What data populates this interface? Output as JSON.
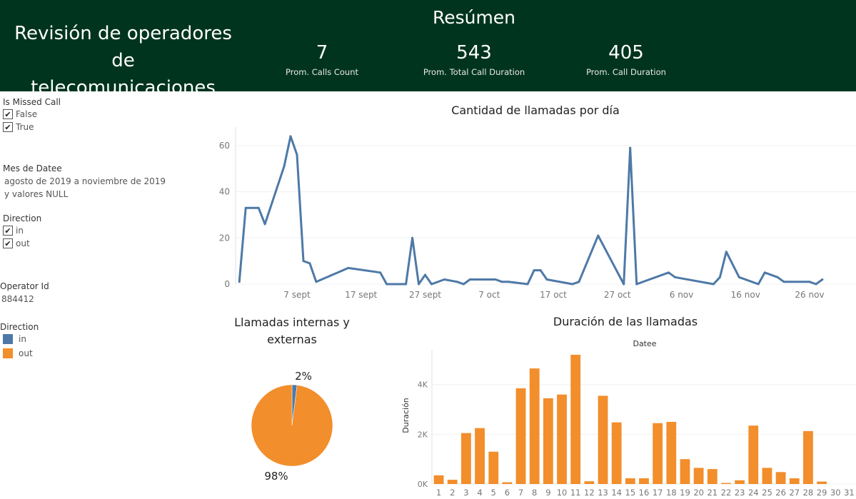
{
  "header": {
    "title_line1": "Revisión de operadores de",
    "title_line2": "telecomunicaciones",
    "summary_title": "Resúmen",
    "kpis": [
      {
        "value": "7",
        "label": "Prom. Calls Count"
      },
      {
        "value": "543",
        "label": "Prom. Total Call Duration"
      },
      {
        "value": "405",
        "label": "Prom. Call Duration"
      }
    ]
  },
  "filters": {
    "missed": {
      "title": "Is Missed Call",
      "options": [
        "False",
        "True"
      ]
    },
    "month": {
      "title": "Mes de Datee",
      "line1": "agosto de 2019 a noviembre de 2019",
      "line2": "y valores NULL"
    },
    "direction": {
      "title": "Direction",
      "options": [
        "in",
        "out"
      ]
    },
    "operator": {
      "title": "Operator Id",
      "value": "884412"
    },
    "legend": {
      "title": "Direction",
      "items": [
        "in",
        "out"
      ]
    }
  },
  "colors": {
    "header_bg": "#01341f",
    "in": "#4e79a7",
    "out": "#f28e2b"
  },
  "chart_data": [
    {
      "type": "line",
      "title": "Cantidad de llamadas por día",
      "color": "#4e79a7",
      "ylim": [
        0,
        68
      ],
      "y_ticks": [
        "0",
        "20",
        "40",
        "60"
      ],
      "x_ticks": [
        "7 sept",
        "17 sept",
        "27 sept",
        "7 oct",
        "17 oct",
        "27 oct",
        "6 nov",
        "16 nov",
        "26 nov"
      ],
      "tick_dates": [
        "2019-09-07",
        "2019-09-17",
        "2019-09-27",
        "2019-10-07",
        "2019-10-17",
        "2019-10-27",
        "2019-11-06",
        "2019-11-16",
        "2019-11-26"
      ],
      "x": [
        "2019-08-29",
        "2019-08-30",
        "2019-09-01",
        "2019-09-02",
        "2019-09-05",
        "2019-09-06",
        "2019-09-07",
        "2019-09-08",
        "2019-09-09",
        "2019-09-10",
        "2019-09-15",
        "2019-09-20",
        "2019-09-21",
        "2019-09-24",
        "2019-09-25",
        "2019-09-26",
        "2019-09-27",
        "2019-09-28",
        "2019-09-30",
        "2019-10-02",
        "2019-10-03",
        "2019-10-04",
        "2019-10-08",
        "2019-10-09",
        "2019-10-10",
        "2019-10-13",
        "2019-10-14",
        "2019-10-15",
        "2019-10-16",
        "2019-10-20",
        "2019-10-21",
        "2019-10-24",
        "2019-10-28",
        "2019-10-29",
        "2019-10-30",
        "2019-11-04",
        "2019-11-05",
        "2019-11-11",
        "2019-11-12",
        "2019-11-13",
        "2019-11-15",
        "2019-11-18",
        "2019-11-19",
        "2019-11-21",
        "2019-11-22",
        "2019-11-26",
        "2019-11-27",
        "2019-11-28"
      ],
      "y": [
        1,
        33,
        33,
        26,
        51,
        64,
        56,
        10,
        9,
        1,
        7,
        5,
        0,
        0,
        20,
        0,
        4,
        0,
        2,
        1,
        0,
        2,
        2,
        1,
        1,
        0,
        6,
        6,
        2,
        0,
        1,
        21,
        0,
        59,
        0,
        5,
        3,
        0,
        3,
        14,
        3,
        0,
        5,
        3,
        1,
        1,
        0,
        2
      ]
    },
    {
      "type": "pie",
      "title_line1": "Llamadas internas y",
      "title_line2": "externas",
      "labels": [
        "in",
        "out"
      ],
      "values": [
        2,
        98
      ],
      "value_labels": [
        "2%",
        "98%"
      ]
    },
    {
      "type": "bar",
      "title": "Duración de las llamadas",
      "xlabel": "Datee",
      "ylabel": "Duración",
      "color": "#f28e2b",
      "ylim": [
        0,
        5400
      ],
      "y_tick_values": [
        0,
        2000,
        4000
      ],
      "y_ticks": [
        "0K",
        "2K",
        "4K"
      ],
      "categories": [
        "1",
        "2",
        "3",
        "4",
        "5",
        "6",
        "7",
        "8",
        "9",
        "10",
        "11",
        "12",
        "13",
        "14",
        "15",
        "16",
        "17",
        "18",
        "19",
        "20",
        "21",
        "22",
        "23",
        "24",
        "25",
        "26",
        "27",
        "28",
        "29",
        "30",
        "31"
      ],
      "values": [
        350,
        170,
        2050,
        2250,
        1300,
        70,
        3850,
        4650,
        3450,
        3600,
        5200,
        110,
        3550,
        2480,
        230,
        230,
        2450,
        2500,
        1000,
        650,
        600,
        30,
        150,
        2350,
        650,
        480,
        230,
        2130,
        100,
        0,
        0
      ]
    }
  ]
}
